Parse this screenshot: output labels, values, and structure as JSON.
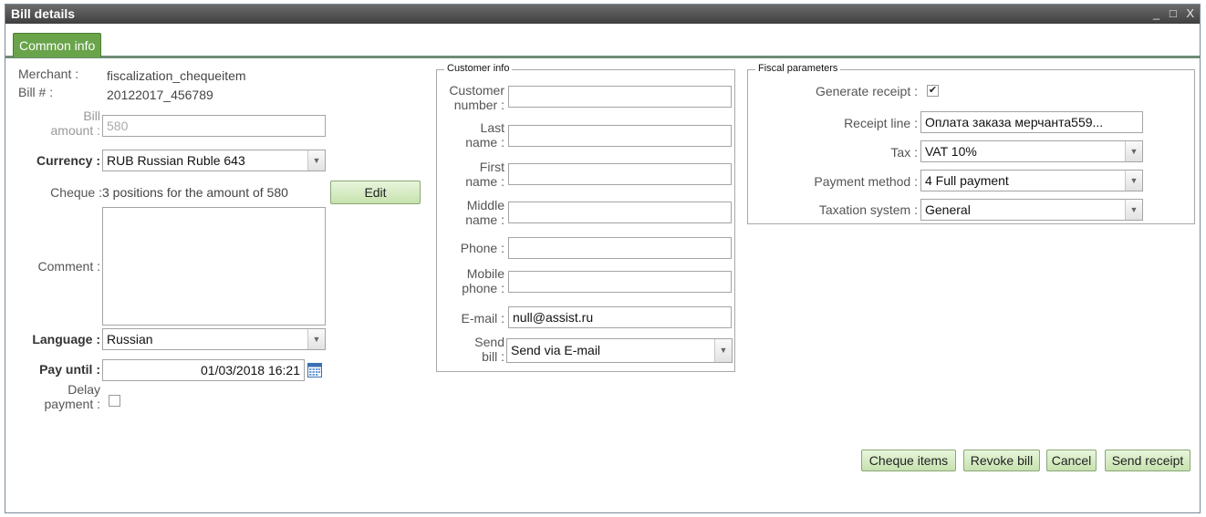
{
  "window": {
    "title": "Bill details",
    "controls": [
      "_",
      "□",
      "X"
    ]
  },
  "tabs": [
    {
      "label": "Common info"
    }
  ],
  "left": {
    "merchant_label": "Merchant :",
    "merchant_value": "fiscalization_chequeitem",
    "bill_label": "Bill # :",
    "bill_value": "20122017_456789",
    "amount_label_1": "Bill",
    "amount_label_2": "amount :",
    "amount_value": "580",
    "currency_label": "Currency :",
    "currency_value": "RUB Russian Ruble 643",
    "cheque_label": "Cheque :",
    "cheque_value": "3 positions for the amount of 580",
    "edit_button": "Edit",
    "comment_label": "Comment :",
    "comment_value": "",
    "language_label": "Language :",
    "language_value": "Russian",
    "pay_until_label": "Pay until :",
    "pay_until_value": "01/03/2018 16:21",
    "delay_label_1": "Delay",
    "delay_label_2": "payment :",
    "delay_checked": false
  },
  "customer": {
    "legend": "Customer info",
    "number_label_1": "Customer",
    "number_label_2": "number :",
    "number_value": "",
    "last_label_1": "Last",
    "last_label_2": "name :",
    "last_value": "",
    "first_label_1": "First",
    "first_label_2": "name :",
    "first_value": "",
    "middle_label_1": "Middle",
    "middle_label_2": "name :",
    "middle_value": "",
    "phone_label": "Phone :",
    "phone_value": "",
    "mobile_label_1": "Mobile",
    "mobile_label_2": "phone :",
    "mobile_value": "",
    "email_label": "E-mail :",
    "email_value": "null@assist.ru",
    "send_label_1": "Send",
    "send_label_2": "bill :",
    "send_value": "Send via E-mail"
  },
  "fiscal": {
    "legend": "Fiscal parameters",
    "generate_label": "Generate receipt :",
    "generate_checked": true,
    "receipt_line_label": "Receipt line :",
    "receipt_line_value": "Оплата заказа мерчанта559...",
    "tax_label": "Tax :",
    "tax_value": "VAT 10%",
    "payment_method_label": "Payment method :",
    "payment_method_value": "4 Full payment",
    "taxation_label": "Taxation system :",
    "taxation_value": "General"
  },
  "actions": {
    "cheque_items": "Cheque items",
    "revoke_bill": "Revoke bill",
    "cancel": "Cancel",
    "send_receipt": "Send receipt"
  },
  "colors": {
    "tab_active": "#69a44a",
    "button_bg": "#d6ebc3",
    "titlebar": "#4a4a4a"
  }
}
